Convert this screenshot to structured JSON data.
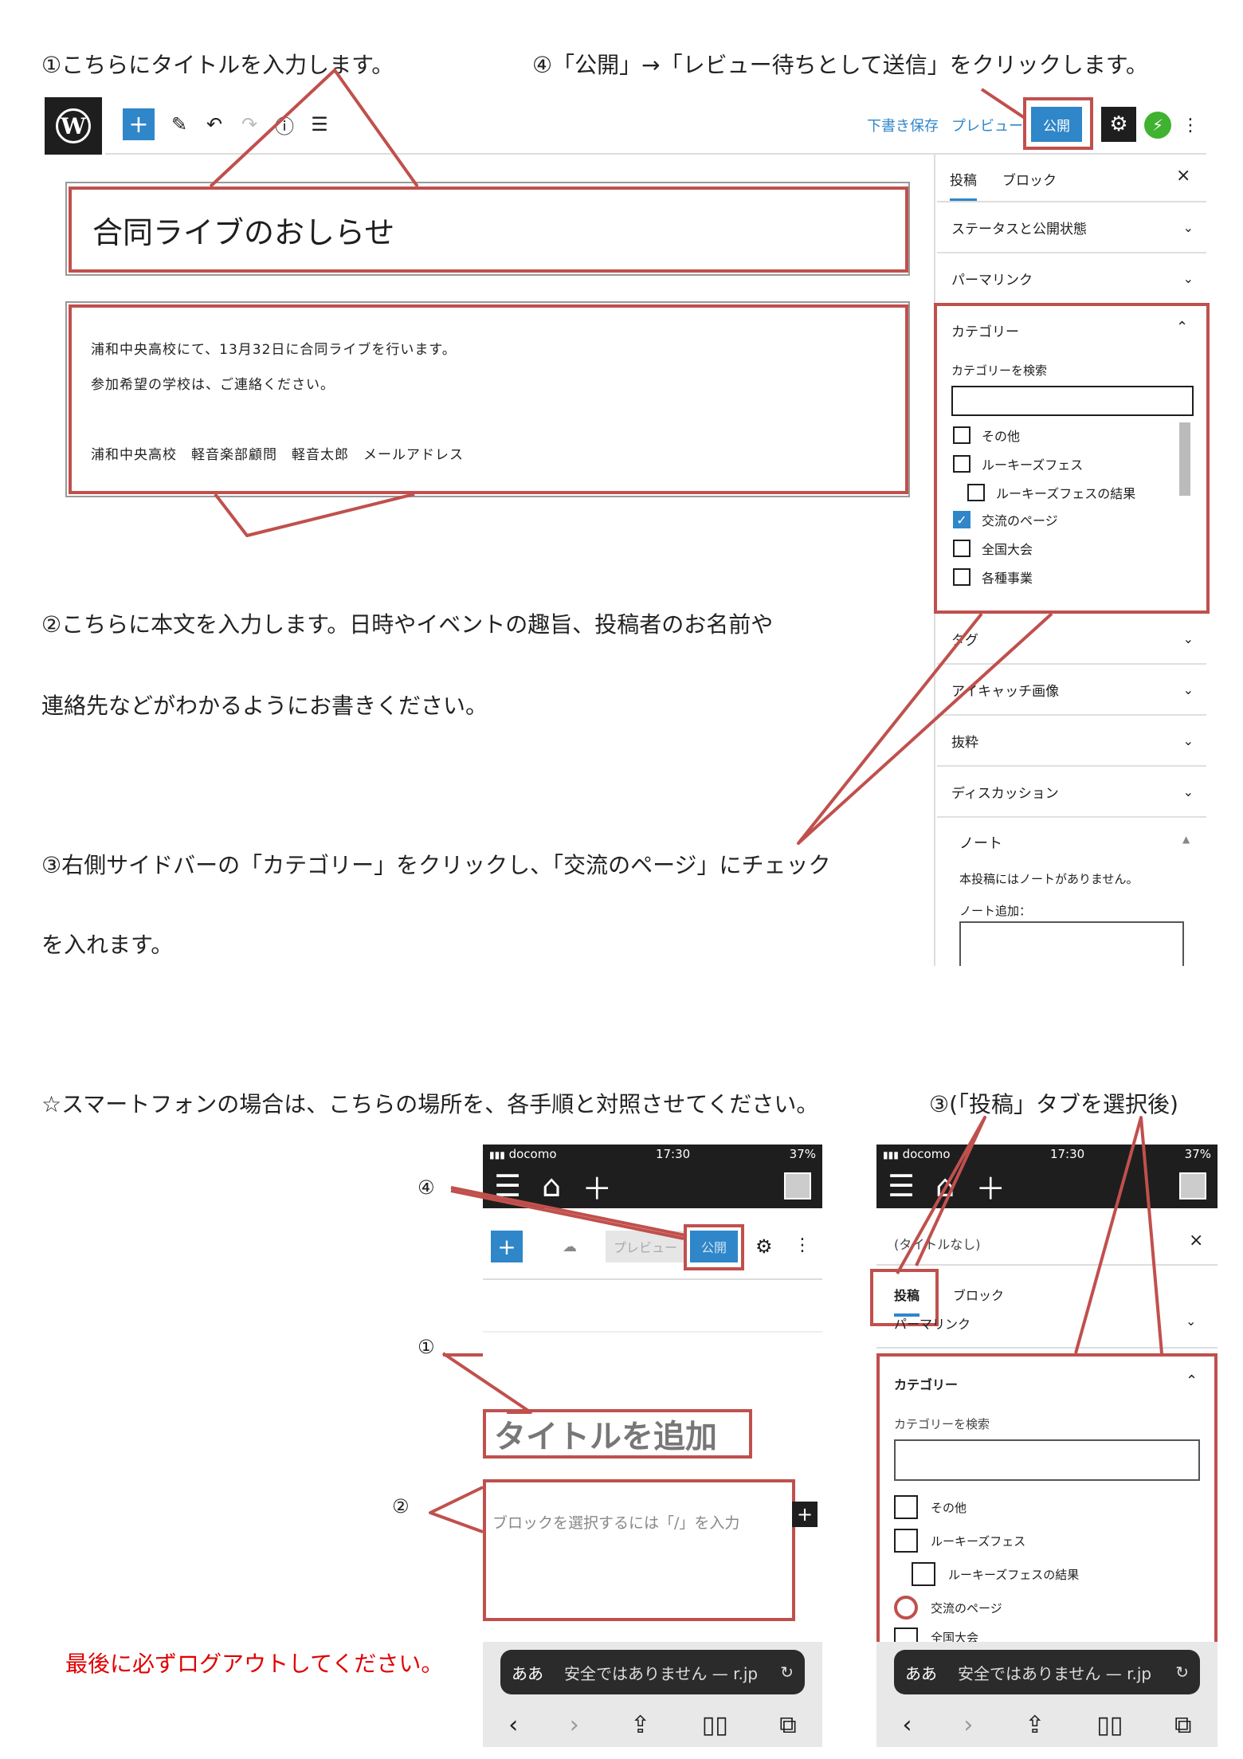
{
  "instructions": {
    "step1": "①こちらにタイトルを入力します。",
    "step4": "④「公開」→「レビュー待ちとして送信」をクリックします。",
    "step2_line1": "②こちらに本文を入力します。日時やイベントの趣旨、投稿者のお名前や",
    "step2_line2": "連絡先などがわかるようにお書きください。",
    "step3_line1": "③右側サイドバーの「カテゴリー」をクリックし、「交流のページ」にチェック",
    "step3_line2": "を入れます。",
    "smartphone_note": "☆スマートフォンの場合は、こちらの場所を、各手順と対照させてください。",
    "step3_phone": "③(「投稿」タブを選択後)",
    "logout_warning": "最後に必ずログアウトしてください。"
  },
  "editor": {
    "toolbar": {
      "draft_save": "下書き保存",
      "preview": "プレビュー",
      "publish": "公開"
    },
    "post_title": "合同ライブのおしらせ",
    "body_lines": [
      "浦和中央高校にて、13月32日に合同ライブを行います。",
      "参加希望の学校は、ご連絡ください。",
      "浦和中央高校　軽音楽部顧問　軽音太郎　メールアドレス"
    ],
    "sidebar": {
      "tab_post": "投稿",
      "tab_block": "ブロック",
      "close": "×",
      "status_visibility": "ステータスと公開状態",
      "permalink": "パーマリンク",
      "category": "カテゴリー",
      "category_search_label": "カテゴリーを検索",
      "categories": [
        {
          "label": "その他",
          "checked": false,
          "indent": false
        },
        {
          "label": "ルーキーズフェス",
          "checked": false,
          "indent": false
        },
        {
          "label": "ルーキーズフェスの結果",
          "checked": false,
          "indent": true
        },
        {
          "label": "交流のページ",
          "checked": true,
          "indent": false
        },
        {
          "label": "全国大会",
          "checked": false,
          "indent": false
        },
        {
          "label": "各種事業",
          "checked": false,
          "indent": false
        }
      ],
      "tag": "タグ",
      "eyecatch": "アイキャッチ画像",
      "excerpt": "抜粋",
      "discussion": "ディスカッション",
      "note_title": "ノート",
      "note_empty": "本投稿にはノートがありません。",
      "note_add": "ノート追加："
    }
  },
  "phone_left": {
    "carrier": "docomo",
    "time": "17:30",
    "battery": "37%",
    "preview": "プレビュー",
    "publish": "公開",
    "title_placeholder": "タイトルを追加",
    "block_placeholder": "ブロックを選択するには「/」を入力",
    "url_aa": "ああ",
    "url_text": "安全ではありません — r.jp",
    "markers": {
      "one": "①",
      "two": "②",
      "four": "④"
    }
  },
  "phone_right": {
    "carrier": "docomo",
    "time": "17:30",
    "battery": "37%",
    "doc_title": "(タイトルなし)",
    "close": "×",
    "tab_post": "投稿",
    "tab_block": "ブロック",
    "permalink_partial": "パーマリンク",
    "category": "カテゴリー",
    "category_search_label": "カテゴリーを検索",
    "categories": [
      {
        "label": "その他",
        "indent": false
      },
      {
        "label": "ルーキーズフェス",
        "indent": false
      },
      {
        "label": "ルーキーズフェスの結果",
        "indent": true
      },
      {
        "label": "交流のページ",
        "indent": false
      },
      {
        "label": "全国大会",
        "indent": false
      }
    ],
    "url_aa": "ああ",
    "url_text": "安全ではありません — r.jp"
  },
  "colors": {
    "annotation_red": "#c0504d",
    "wp_blue": "#2f86c9",
    "warning_red": "#e00000"
  }
}
